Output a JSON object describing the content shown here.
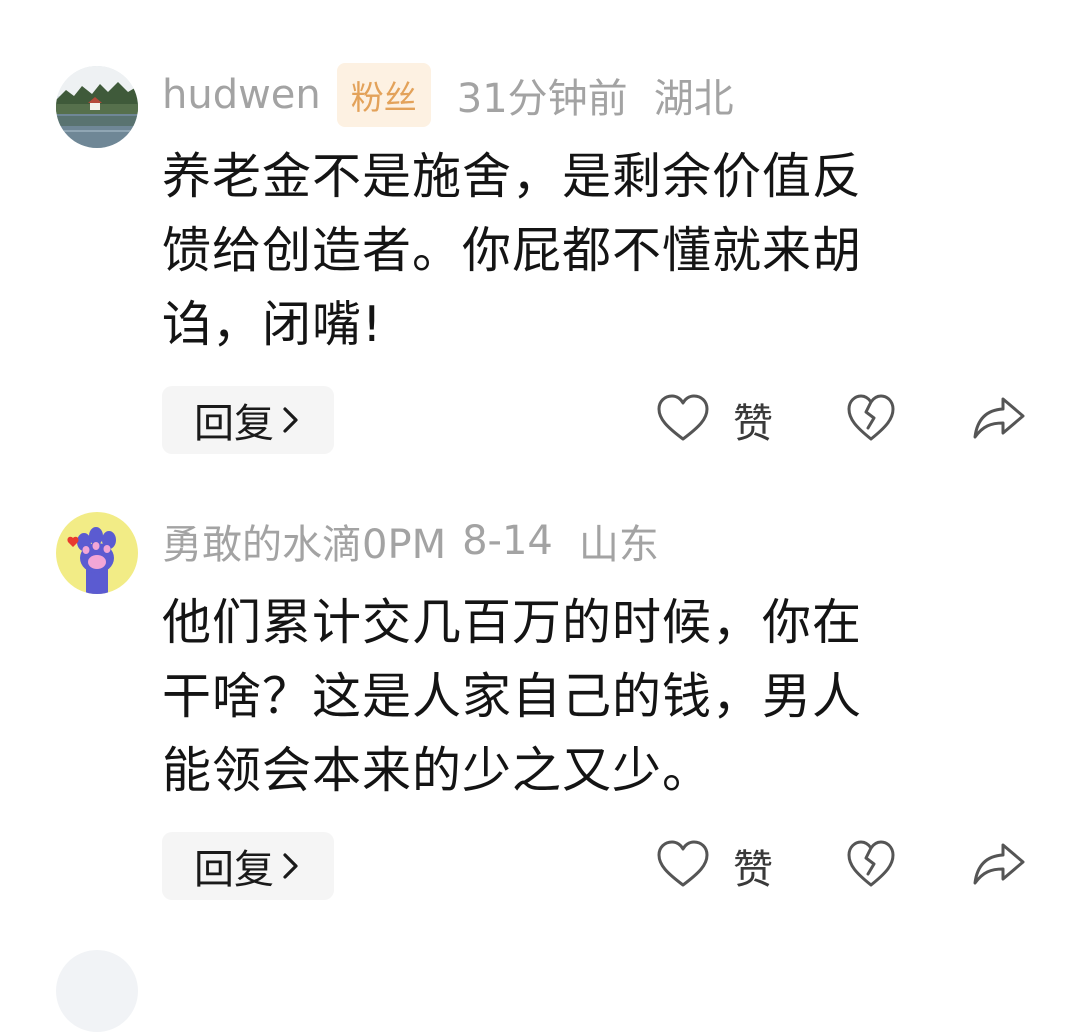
{
  "comments": [
    {
      "username": "hudwen",
      "badge": "粉丝",
      "time": "31分钟前",
      "location": "湖北",
      "lines": [
        "养老金不是施舍，是剩余价值反",
        "馈给创造者。你屁都不懂就来胡",
        "诌，闭嘴!"
      ],
      "avatar_icon": "lake-landscape-avatar",
      "reply_label": "回复",
      "like_label": "赞"
    },
    {
      "username": "勇敢的水滴0PM",
      "badge": "",
      "time": "8-14",
      "location": "山东",
      "lines": [
        "他们累计交几百万的时候，你在",
        "干啥？这是人家自己的钱，男人",
        "能领会本来的少之又少。"
      ],
      "avatar_icon": "cat-paw-avatar",
      "reply_label": "回复",
      "like_label": "赞"
    }
  ],
  "colors": {
    "meta_text": "#a3a3a3",
    "badge_bg": "#fdf1e2",
    "badge_text": "#e3a25a",
    "body_text": "#141414",
    "reply_bg": "#f5f5f5",
    "icon_stroke": "#555555"
  },
  "icons": {
    "chevron": "chevron-right-icon",
    "like": "heart-icon",
    "dislike": "broken-heart-icon",
    "share": "share-arrow-icon"
  }
}
